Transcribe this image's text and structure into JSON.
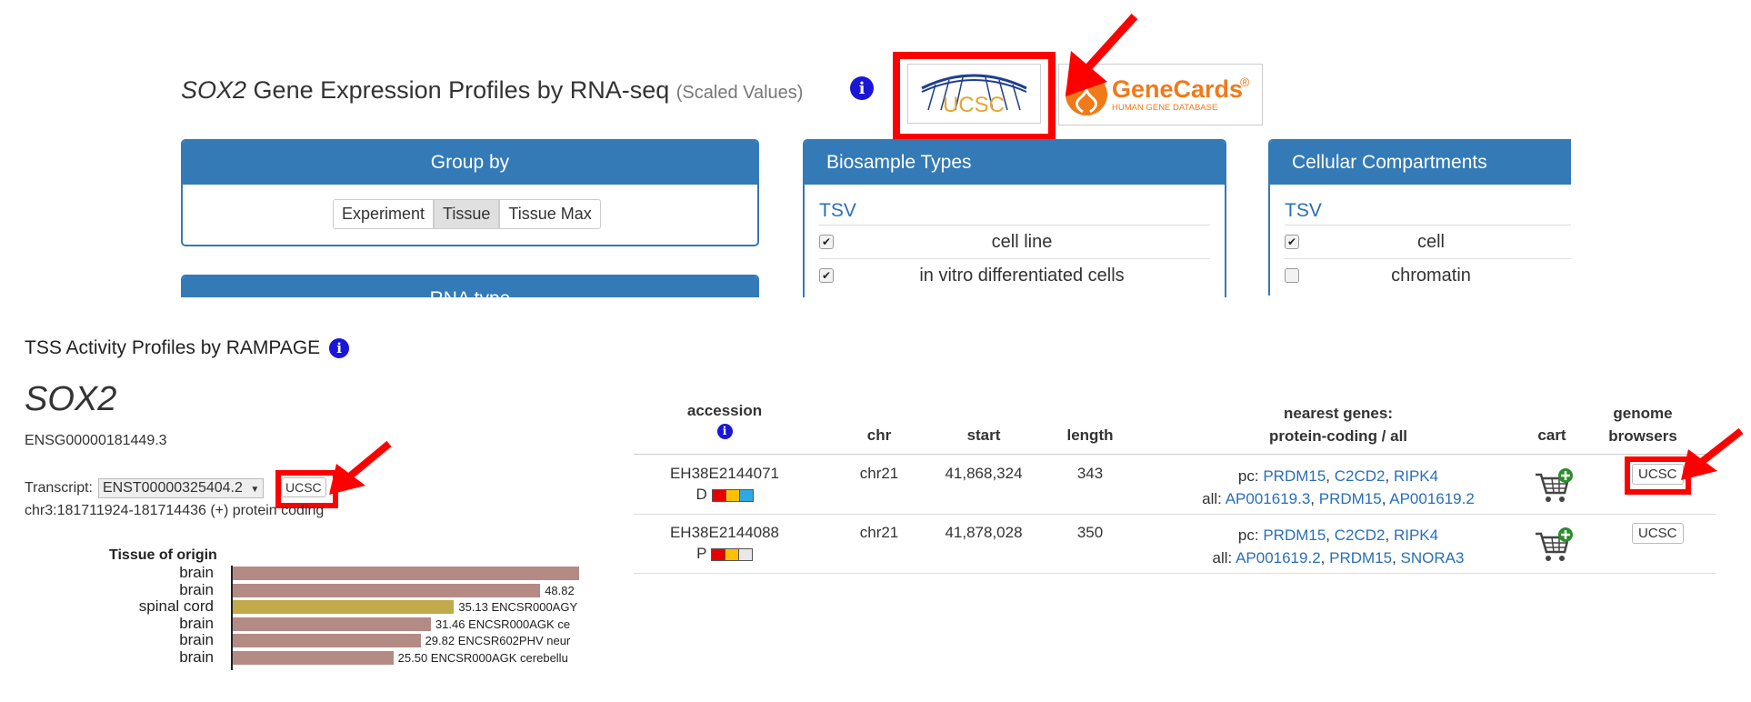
{
  "rna": {
    "gene": "SOX2",
    "title_rest": " Gene Expression Profiles by RNA-seq ",
    "scaled": "(Scaled Values)",
    "info_glyph": "i",
    "group_by": {
      "title": "Group by",
      "buttons": [
        "Experiment",
        "Tissue",
        "Tissue Max"
      ],
      "active": "Tissue"
    },
    "rna_type_label": "RNA type",
    "biosample": {
      "title": "Biosample Types",
      "tsv": "TSV",
      "rows": [
        {
          "label": "cell line",
          "checked": true
        },
        {
          "label": "in vitro differentiated cells",
          "checked": true
        }
      ]
    },
    "compartments": {
      "title": "Cellular Compartments",
      "tsv": "TSV",
      "rows": [
        {
          "label": "cell",
          "checked": true
        },
        {
          "label": "chromatin",
          "checked": false
        }
      ]
    },
    "ucsc_logo_text": "UCSC",
    "genecards": {
      "name": "GeneCards",
      "reg": "®",
      "subtitle": "HUMAN GENE DATABASE"
    }
  },
  "tss": {
    "heading": "TSS Activity Profiles by RAMPAGE",
    "gene": "SOX2",
    "ensembl": "ENSG00000181449.3",
    "transcript_label": "Transcript:",
    "transcript_value": "ENST00000325404.2",
    "ucsc_button": "UCSC",
    "locus": "chr3:181711924-181714436 (+) protein coding",
    "chart_title": "Tissue of origin"
  },
  "chart_data": {
    "type": "bar",
    "title": "Tissue of origin",
    "categories": [
      "brain",
      "brain",
      "spinal cord",
      "brain",
      "brain",
      "brain"
    ],
    "values": [
      55,
      48.82,
      35.13,
      31.46,
      29.82,
      25.5
    ],
    "labels": [
      "",
      "48.82",
      "35.13 ENCSR000AGY",
      "31.46 ENCSR000AGK ce",
      "29.82 ENCSR602PHV neur",
      "25.50 ENCSR000AGK cerebellu"
    ],
    "colors": [
      "#b48a85",
      "#b48a85",
      "#c0aa4a",
      "#b48a85",
      "#b48a85",
      "#b48a85"
    ],
    "xlim": [
      0,
      55
    ]
  },
  "table": {
    "headers": {
      "accession": "accession",
      "chr": "chr",
      "start": "start",
      "length": "length",
      "nearest_line1": "nearest genes:",
      "nearest_line2": "protein-coding / all",
      "cart": "cart",
      "genome_line1": "genome",
      "genome_line2": "browsers"
    },
    "rows": [
      {
        "accession": "EH38E2144071",
        "group": "D",
        "colors": [
          "#e60000",
          "#ffc000",
          "#2ea8e6"
        ],
        "chr": "chr21",
        "start": "41,868,324",
        "length": "343",
        "pc_label": "pc:",
        "pc": [
          "PRDM15",
          "C2CD2",
          "RIPK4"
        ],
        "all_label": "all:",
        "all": [
          "AP001619.3",
          "PRDM15",
          "AP001619.2"
        ],
        "ucsc": "UCSC"
      },
      {
        "accession": "EH38E2144088",
        "group": "P",
        "colors": [
          "#e60000",
          "#ffc000",
          "#e8e8e8"
        ],
        "chr": "chr21",
        "start": "41,878,028",
        "length": "350",
        "pc_label": "pc:",
        "pc": [
          "PRDM15",
          "C2CD2",
          "RIPK4"
        ],
        "all_label": "all:",
        "all": [
          "AP001619.2",
          "PRDM15",
          "SNORA3"
        ],
        "ucsc": "UCSC"
      }
    ]
  }
}
